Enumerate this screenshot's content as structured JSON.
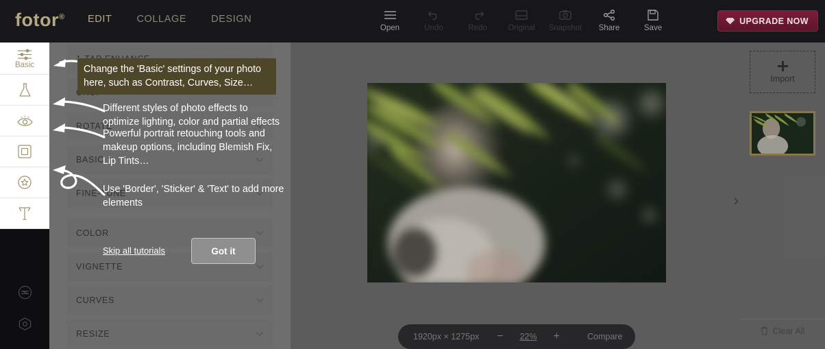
{
  "app": {
    "brand": "fotor",
    "brand_mark": "®",
    "accent": "#b5a882",
    "upgrade_color": "#7d1c38"
  },
  "topbar": {
    "tabs": [
      {
        "label": "EDIT",
        "active": true
      },
      {
        "label": "COLLAGE",
        "active": false
      },
      {
        "label": "DESIGN",
        "active": false
      }
    ],
    "tools": [
      {
        "label": "Open",
        "icon": "hamburger-icon",
        "enabled": true
      },
      {
        "label": "Undo",
        "icon": "undo-icon",
        "enabled": false
      },
      {
        "label": "Redo",
        "icon": "redo-icon",
        "enabled": false
      },
      {
        "label": "Original",
        "icon": "original-icon",
        "enabled": false
      },
      {
        "label": "Snapshot",
        "icon": "snapshot-icon",
        "enabled": false
      },
      {
        "label": "Share",
        "icon": "share-icon",
        "enabled": true
      },
      {
        "label": "Save",
        "icon": "save-icon",
        "enabled": true
      }
    ],
    "upgrade_label": "UPGRADE NOW",
    "upgrade_icon": "diamond-icon"
  },
  "sidebar": {
    "items": [
      {
        "label": "Basic",
        "icon": "sliders-icon",
        "active": true
      },
      {
        "label": "",
        "icon": "flask-effects-icon",
        "active": false
      },
      {
        "label": "",
        "icon": "eye-beauty-icon",
        "active": false
      },
      {
        "label": "",
        "icon": "frame-border-icon",
        "active": false
      },
      {
        "label": "",
        "icon": "sticker-star-icon",
        "active": false
      },
      {
        "label": "",
        "icon": "text-t-icon",
        "active": false
      }
    ],
    "bottom_items": [
      {
        "icon": "feedback-icon"
      },
      {
        "icon": "gear-settings-icon"
      }
    ]
  },
  "panel": {
    "rows": [
      {
        "label": "1-TAP ENHANCE",
        "chevron": "chevron-down-icon"
      },
      {
        "label": "CROP",
        "chevron": "chevron-down-icon"
      },
      {
        "label": "ROTATE",
        "chevron": "chevron-down-icon"
      },
      {
        "label": "BASIC",
        "chevron": "chevron-down-icon"
      },
      {
        "label": "FINE-TUNE",
        "chevron": "chevron-down-icon"
      },
      {
        "label": "COLOR",
        "chevron": "chevron-down-icon"
      },
      {
        "label": "VIGNETTE",
        "chevron": "chevron-down-icon"
      },
      {
        "label": "CURVES",
        "chevron": "chevron-down-icon"
      },
      {
        "label": "RESIZE",
        "chevron": "chevron-down-icon"
      }
    ]
  },
  "tutorial": {
    "tips": [
      {
        "text": "Change the 'Basic' settings of your photo here, such as Contrast, Curves, Size…",
        "highlighted": true,
        "highlight_color": "#4d4629"
      },
      {
        "text": "Different styles of photo effects to optimize lighting, color and partial effects",
        "highlighted": false
      },
      {
        "text": "Powerful portrait retouching tools and makeup options, including Blemish Fix, Lip Tints…",
        "highlighted": false
      },
      {
        "text": "Use 'Border', 'Sticker' & 'Text' to add more elements",
        "highlighted": false
      }
    ],
    "skip_label": "Skip all tutorials",
    "confirm_label": "Got it"
  },
  "canvas": {
    "zoombar": {
      "dimensions": "1920px × 1275px",
      "zoom_out": "−",
      "zoom_level": "22%",
      "zoom_in": "+",
      "compare_label": "Compare"
    },
    "collapse_icon": "chevron-right-icon"
  },
  "rightpanel": {
    "import_label": "Import",
    "import_icon": "plus-icon",
    "thumbnail": {
      "selected": true,
      "border_color": "#9a8b5c"
    },
    "clear_all_label": "Clear All",
    "clear_all_icon": "trash-icon"
  }
}
